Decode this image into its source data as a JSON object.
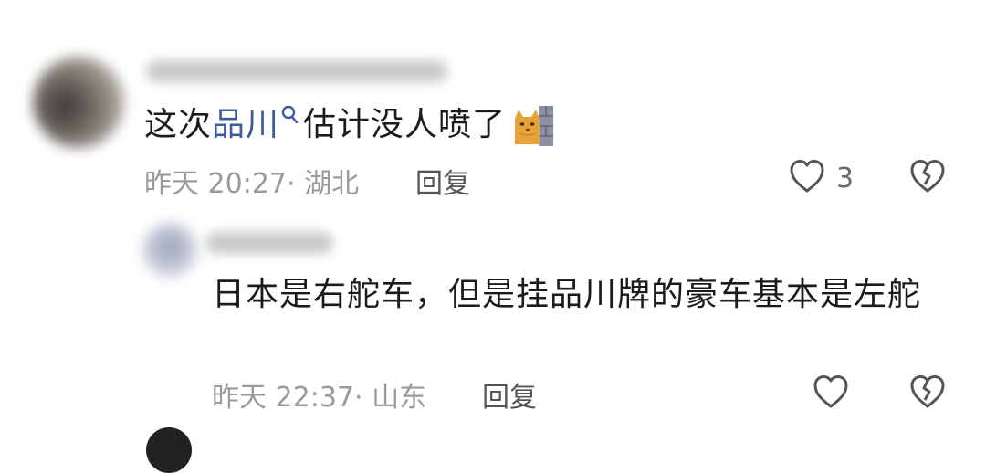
{
  "comments": [
    {
      "text_before": "这次",
      "link_text": "品川",
      "text_after": "估计没人喷了",
      "emoji": "cat-peeking-from-wall-emoji",
      "time": "昨天 20:27",
      "location": "· 湖北",
      "reply_label": "回复",
      "like_count": "3"
    },
    {
      "text": "日本是右舵车，但是挂品川牌的豪车基本是左舵",
      "time": "昨天 22:37",
      "location": "· 山东",
      "reply_label": "回复"
    }
  ],
  "colors": {
    "link": "#3d5a99",
    "meta": "#9a9a9a",
    "text": "#1b1b1b"
  }
}
